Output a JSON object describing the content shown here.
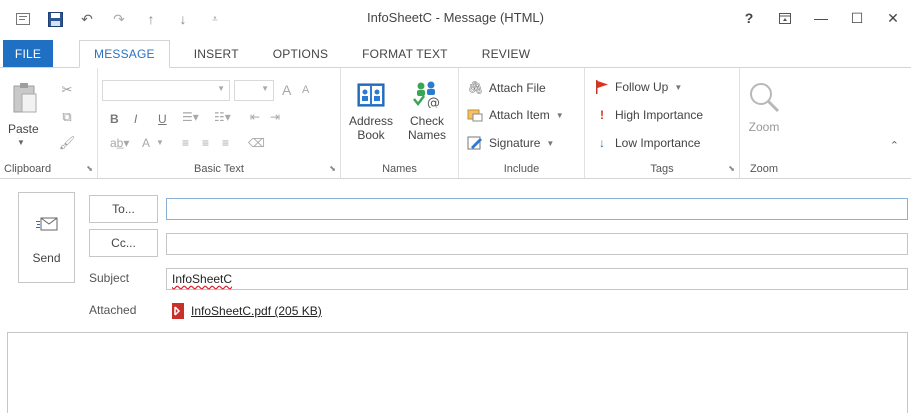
{
  "window": {
    "title": "InfoSheetC - Message (HTML)",
    "help": "?",
    "restore": "▭",
    "minimize": "—",
    "maximize": "☐",
    "close": "✕"
  },
  "tabs": [
    {
      "label": "FILE"
    },
    {
      "label": "MESSAGE"
    },
    {
      "label": "INSERT"
    },
    {
      "label": "OPTIONS"
    },
    {
      "label": "FORMAT TEXT"
    },
    {
      "label": "REVIEW"
    }
  ],
  "ribbon": {
    "clipboard": {
      "label": "Clipboard",
      "paste": "Paste"
    },
    "basic_text": {
      "label": "Basic Text",
      "bold": "B",
      "italic": "I",
      "underline": "U",
      "grow": "A",
      "shrink": "A",
      "font_color": "A"
    },
    "names": {
      "label": "Names",
      "address_book_line1": "Address",
      "address_book_line2": "Book",
      "check_names_line1": "Check",
      "check_names_line2": "Names"
    },
    "include": {
      "label": "Include",
      "attach_file": "Attach File",
      "attach_item": "Attach Item",
      "signature": "Signature"
    },
    "tags": {
      "label": "Tags",
      "follow_up": "Follow Up",
      "high_importance": "High Importance",
      "low_importance": "Low Importance"
    },
    "zoom": {
      "label": "Zoom",
      "zoom_button": "Zoom"
    }
  },
  "compose": {
    "send": "Send",
    "to_button": "To...",
    "cc_button": "Cc...",
    "to_value": "",
    "cc_value": "",
    "subject_label": "Subject",
    "subject_value": "InfoSheetC",
    "attached_label": "Attached",
    "attachment": "InfoSheetC.pdf (205 KB)"
  }
}
